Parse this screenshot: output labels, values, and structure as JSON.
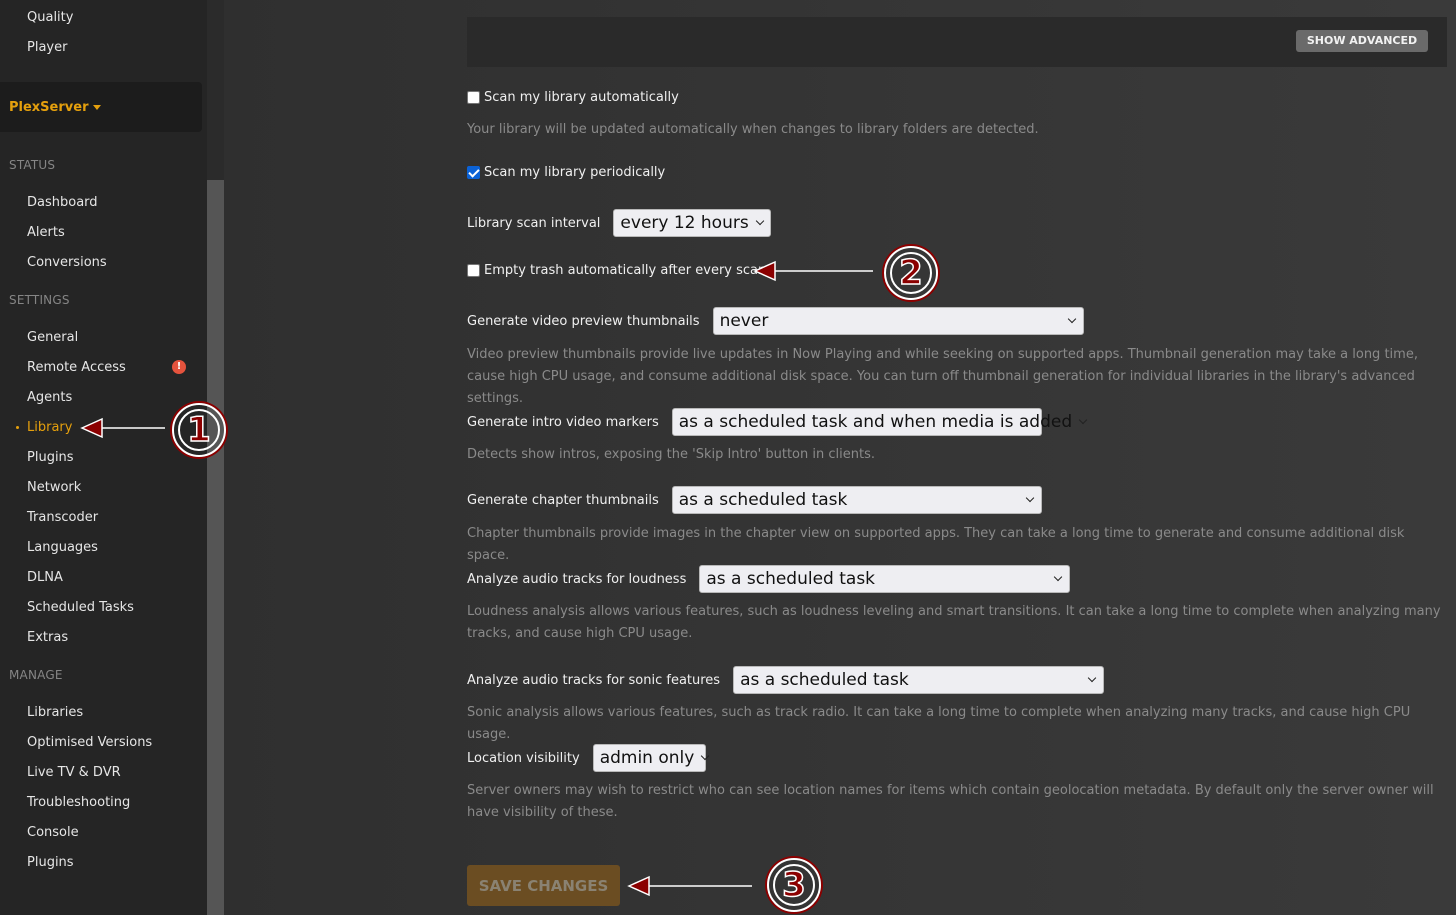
{
  "sidebar": {
    "top_items": [
      {
        "label": "Quality"
      },
      {
        "label": "Player"
      }
    ],
    "server": {
      "name": "PlexServer"
    },
    "sections": [
      {
        "header": "STATUS",
        "items": [
          {
            "label": "Dashboard"
          },
          {
            "label": "Alerts"
          },
          {
            "label": "Conversions"
          }
        ]
      },
      {
        "header": "SETTINGS",
        "items": [
          {
            "label": "General"
          },
          {
            "label": "Remote Access",
            "badge": "!"
          },
          {
            "label": "Agents"
          },
          {
            "label": "Library",
            "active": true
          },
          {
            "label": "Plugins"
          },
          {
            "label": "Network"
          },
          {
            "label": "Transcoder"
          },
          {
            "label": "Languages"
          },
          {
            "label": "DLNA"
          },
          {
            "label": "Scheduled Tasks"
          },
          {
            "label": "Extras"
          }
        ]
      },
      {
        "header": "MANAGE",
        "items": [
          {
            "label": "Libraries"
          },
          {
            "label": "Optimised Versions"
          },
          {
            "label": "Live TV & DVR"
          },
          {
            "label": "Troubleshooting"
          },
          {
            "label": "Console"
          },
          {
            "label": "Plugins"
          }
        ]
      }
    ]
  },
  "main": {
    "show_advanced_label": "SHOW ADVANCED",
    "scan_auto": {
      "label": "Scan my library automatically",
      "checked": false,
      "help": "Your library will be updated automatically when changes to library folders are detected."
    },
    "scan_periodic": {
      "label": "Scan my library periodically",
      "checked": true
    },
    "scan_interval": {
      "label": "Library scan interval",
      "value": "every 12 hours"
    },
    "empty_trash": {
      "label": "Empty trash automatically after every scan",
      "checked": false
    },
    "video_preview": {
      "label": "Generate video preview thumbnails",
      "value": "never",
      "help": "Video preview thumbnails provide live updates in Now Playing and while seeking on supported apps. Thumbnail generation may take a long time, cause high CPU usage, and consume additional disk space. You can turn off thumbnail generation for individual libraries in the library's advanced settings."
    },
    "intro_markers": {
      "label": "Generate intro video markers",
      "value": "as a scheduled task and when media is added",
      "help": "Detects show intros, exposing the 'Skip Intro' button in clients."
    },
    "chapter_thumbs": {
      "label": "Generate chapter thumbnails",
      "value": "as a scheduled task",
      "help": "Chapter thumbnails provide images in the chapter view on supported apps. They can take a long time to generate and consume additional disk space."
    },
    "loudness": {
      "label": "Analyze audio tracks for loudness",
      "value": "as a scheduled task",
      "help": "Loudness analysis allows various features, such as loudness leveling and smart transitions. It can take a long time to complete when analyzing many tracks, and cause high CPU usage."
    },
    "sonic": {
      "label": "Analyze audio tracks for sonic features",
      "value": "as a scheduled task",
      "help": "Sonic analysis allows various features, such as track radio. It can take a long time to complete when analyzing many tracks, and cause high CPU usage."
    },
    "location": {
      "label": "Location visibility",
      "value": "admin only",
      "help": "Server owners may wish to restrict who can see location names for items which contain geolocation metadata. By default only the server owner will have visibility of these."
    },
    "save_label": "SAVE CHANGES"
  },
  "annotations": [
    {
      "number": "1"
    },
    {
      "number": "2"
    },
    {
      "number": "3"
    }
  ],
  "colors": {
    "accent": "#e5a00d",
    "annotation": "#8b0000",
    "badge": "#e5533d"
  }
}
